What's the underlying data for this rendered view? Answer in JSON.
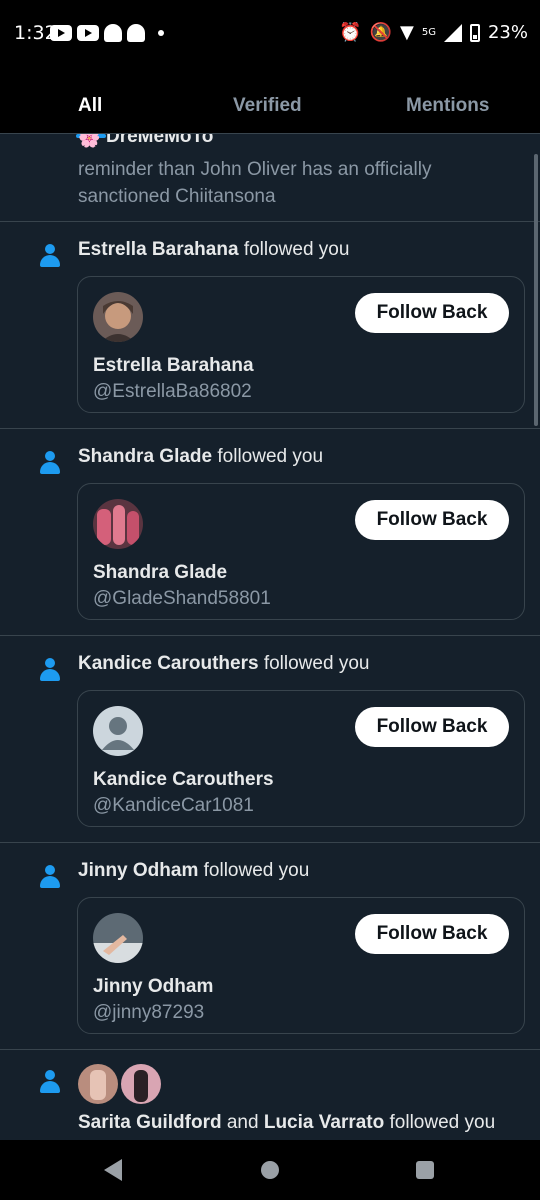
{
  "status_bar": {
    "time": "1:32",
    "network": "5G",
    "battery": "23%"
  },
  "tabs": [
    {
      "label": "All",
      "active": true
    },
    {
      "label": "Verified",
      "active": false
    },
    {
      "label": "Mentions",
      "active": false
    }
  ],
  "partial_post": {
    "name": "DreMeMoTo",
    "text": "reminder than John Oliver has an officially sanctioned Chiitansona"
  },
  "notifications": [
    {
      "name": "Estrella Barahana",
      "action": "followed you",
      "card_name": "Estrella Barahana",
      "handle": "@EstrellaBa86802",
      "button": "Follow Back",
      "avatar_color": "#c79a7d"
    },
    {
      "name": "Shandra Glade",
      "action": "followed you",
      "card_name": "Shandra Glade",
      "handle": "@GladeShand58801",
      "button": "Follow Back",
      "avatar_color": "#b8566b"
    },
    {
      "name": "Kandice Carouthers",
      "action": "followed you",
      "card_name": "Kandice Carouthers",
      "handle": "@KandiceCar1081",
      "button": "Follow Back",
      "avatar_color": "#ccd6dd"
    },
    {
      "name": "Jinny Odham",
      "action": "followed you",
      "card_name": "Jinny Odham",
      "handle": "@jinny87293",
      "button": "Follow Back",
      "avatar_color": "#8e9aa3"
    }
  ],
  "last_notification": {
    "name1": "Sarita Guildford",
    "conjunction": "and",
    "name2": "Lucia Varrato",
    "action": "followed you"
  },
  "colors": {
    "background": "#15202b",
    "accent": "#1d9bf0",
    "muted_text": "#8b98a5",
    "border": "#38444d"
  }
}
